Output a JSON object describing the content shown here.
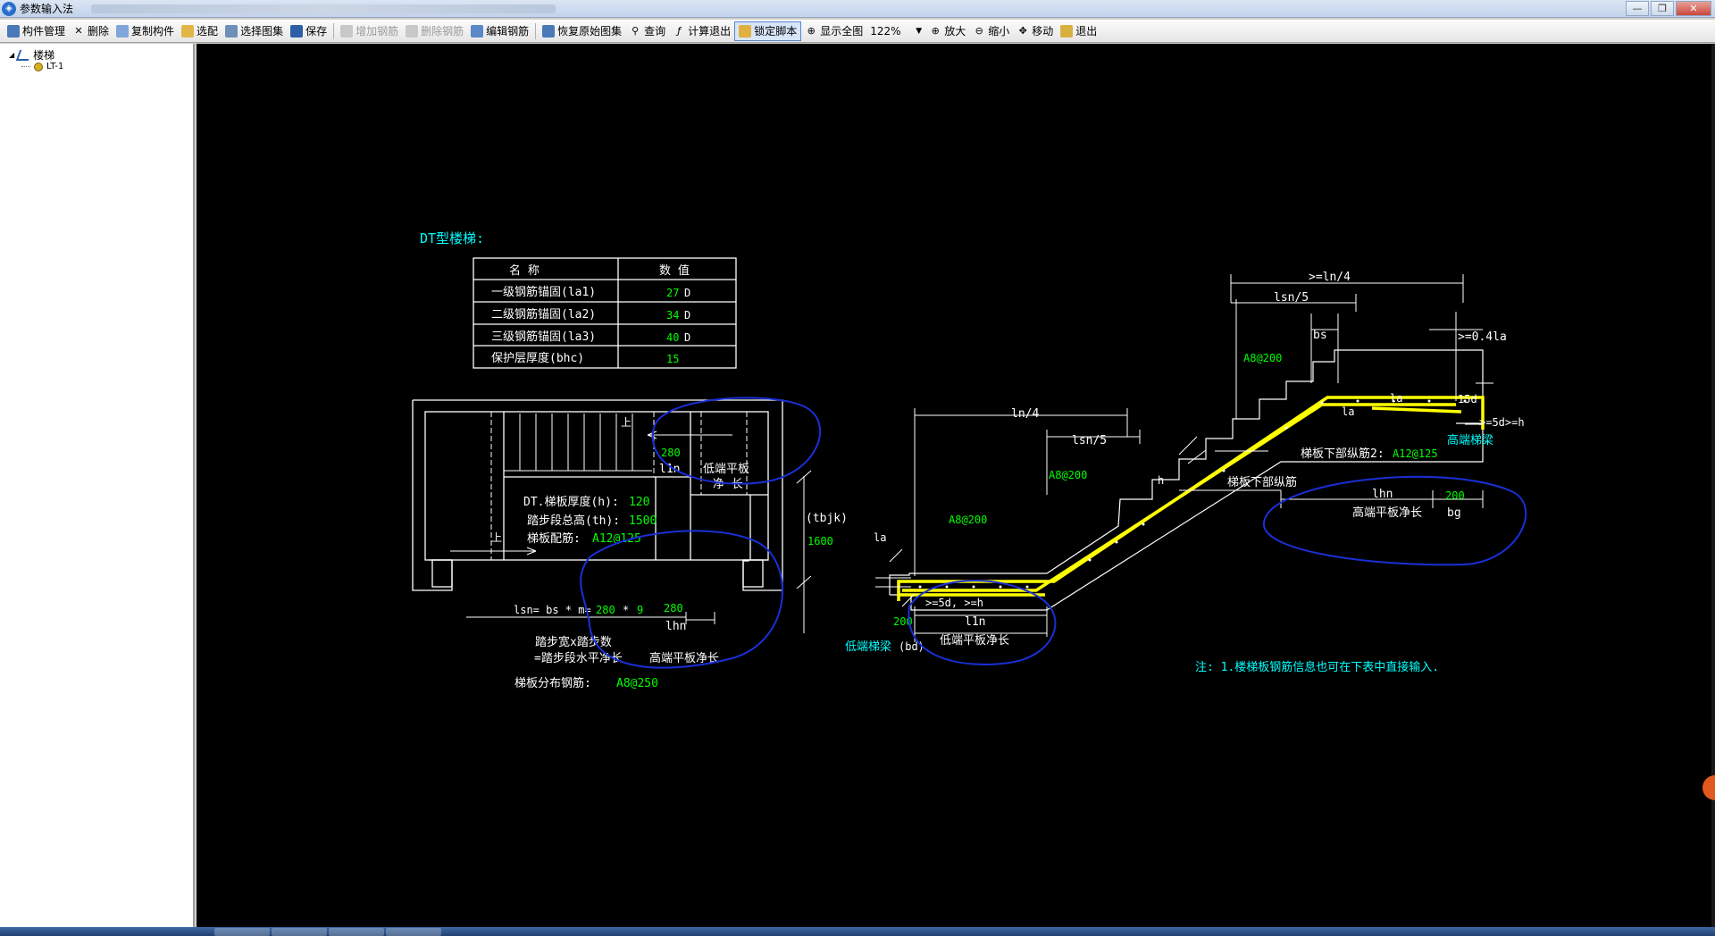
{
  "window": {
    "title": "参数输入法",
    "buttons": {
      "min": "—",
      "max": "❐",
      "close": "✕"
    }
  },
  "toolbar": {
    "items": [
      {
        "label": "构件管理",
        "icon": "component-manage-icon",
        "disabled": false
      },
      {
        "label": "删除",
        "icon": "delete-icon",
        "disabled": false
      },
      {
        "label": "复制构件",
        "icon": "copy-icon",
        "disabled": false
      },
      {
        "label": "选配",
        "icon": "select-match-icon",
        "disabled": false
      },
      {
        "label": "选择图集",
        "icon": "select-atlas-icon",
        "disabled": false
      },
      {
        "label": "保存",
        "icon": "save-icon",
        "disabled": false
      },
      {
        "label": "增加钢筋",
        "icon": "add-rebar-icon",
        "disabled": true
      },
      {
        "label": "删除钢筋",
        "icon": "remove-rebar-icon",
        "disabled": true
      },
      {
        "label": "编辑钢筋",
        "icon": "edit-rebar-icon",
        "disabled": false
      },
      {
        "label": "恢复原始图集",
        "icon": "restore-icon",
        "disabled": false
      },
      {
        "label": "查询",
        "icon": "query-icon",
        "disabled": false
      },
      {
        "label": "计算退出",
        "icon": "calc-exit-icon",
        "disabled": false
      },
      {
        "label": "锁定脚本",
        "icon": "lock-icon",
        "disabled": false,
        "active": true
      },
      {
        "label": "显示全图",
        "icon": "zoom-fit-icon",
        "disabled": false
      }
    ],
    "zoom": "122%",
    "items2": [
      {
        "label": "放大",
        "icon": "zoom-in-icon"
      },
      {
        "label": "缩小",
        "icon": "zoom-out-icon"
      },
      {
        "label": "移动",
        "icon": "pan-icon"
      },
      {
        "label": "退出",
        "icon": "exit-icon"
      }
    ]
  },
  "tree": {
    "root": "楼梯",
    "child": "LT-1"
  },
  "drawing": {
    "title": "DT型楼梯:",
    "table": {
      "headers": [
        "名  称",
        "数  值"
      ],
      "rows": [
        {
          "name": "一级钢筋锚固(la1)",
          "value": "27",
          "unit": "D"
        },
        {
          "name": "二级钢筋锚固(la2)",
          "value": "34",
          "unit": "D"
        },
        {
          "name": "三级钢筋锚固(la3)",
          "value": "40",
          "unit": "D"
        },
        {
          "name": "保护层厚度(bhc)",
          "value": "15",
          "unit": ""
        }
      ]
    },
    "plan": {
      "up1": "上",
      "up2": "上",
      "v280a": "280",
      "l1n": "l1n",
      "low_platform": "低端平板",
      "low_platform2": "净  长",
      "thickness_label": "DT.梯板厚度(h):",
      "thickness_val": "120",
      "height_label": "踏步段总高(th):",
      "height_val": "1500",
      "rebar_label": "梯板配筋:",
      "rebar_val": "A12@125",
      "tbjk": "(tbjk)",
      "v1600": "1600",
      "lsn_label": "lsn= bs * m=",
      "lsn_bs": "280",
      "lsn_star": "*",
      "lsn_m": "9",
      "v280b": "280",
      "lhn": "lhn",
      "step_desc1": "踏步宽x踏步数",
      "step_desc2": "=踏步段水平净长",
      "high_platform": "高端平板净长",
      "dist_label": "梯板分布钢筋:",
      "dist_val": "A8@250"
    },
    "section": {
      "ge_ln4": ">=ln/4",
      "lsn5_top": "lsn/5",
      "bs": "bs",
      "ge041la": ">=0.4la",
      "a8_200_top": "A8@200",
      "v15d": "15d",
      "la1": "la",
      "la2": "la",
      "ge5d_h_top": ">=5d>=h",
      "high_beam": "高端梯梁",
      "lower_rebar2": "梯板下部纵筋2:",
      "lower_rebar2_val": "A12@125",
      "ln4": "ln/4",
      "lsn5_mid": "lsn/5",
      "a8_200_mid": "A8@200",
      "h": "h",
      "lower_rebar": "梯板下部纵筋",
      "lhn": "lhn",
      "v200_high": "200",
      "high_len": "高端平板净长",
      "bg": "bg",
      "a8_200_low": "A8@200",
      "la_low": "la",
      "ge5d_h_low": ">=5d, >=h",
      "v200_low": "200",
      "l1n": "l1n",
      "low_beam": "低端梯梁",
      "bd": "(bd)",
      "low_len": "低端平板净长"
    },
    "note": "注: 1.楼梯板钢筋信息也可在下表中直接输入."
  },
  "colors": {
    "cad_bg": "#000000",
    "green": "#00ff00",
    "cyan": "#00ffff",
    "yellow": "#ffff00",
    "white": "#ffffff",
    "blue_pen": "#1a2fd6"
  }
}
